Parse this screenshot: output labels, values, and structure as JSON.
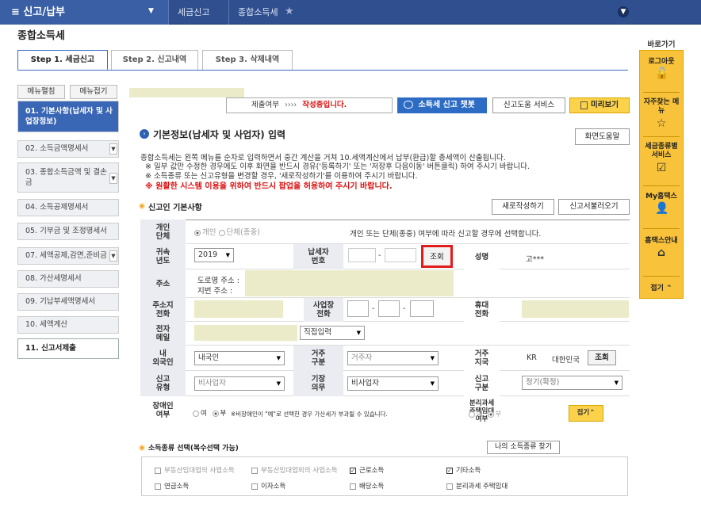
{
  "topbar": {
    "menu_label": "신고/납부",
    "crumb1": "세금신고",
    "crumb2": "종합소득세"
  },
  "page_title": "종합소득세",
  "tabs": [
    "Step 1. 세금신고",
    "Step 2. 신고내역",
    "Step 3. 삭제내역"
  ],
  "leftnav": {
    "expand_all": "메뉴펼침",
    "collapse_all": "메뉴접기",
    "items": [
      "01. 기본사항(납세자 및 사업장정보)",
      "02. 소득금액명세서",
      "03. 종합소득금액 및 결손금",
      "04. 소득공제명세서",
      "05. 기부금 및 조정명세서",
      "07. 세액공제,감면,준비금",
      "08. 가산세명세서",
      "09. 기납부세액명세서",
      "10. 세액계산",
      "11. 신고서제출"
    ]
  },
  "quickmenu": {
    "title": "바로가기",
    "items": [
      "로그아웃",
      "자주찾는 메뉴",
      "세금종류별 서비스",
      "My홈택스",
      "홈택스안내"
    ],
    "fold": "접기 ⌃"
  },
  "status": {
    "label": "제출여부",
    "arrows": "››››",
    "value": "작성중입니다."
  },
  "buttons": {
    "chatbot": "소득세 신고 챗봇",
    "help_service": "신고도움 서비스",
    "preview": "미리보기",
    "screen_help": "화면도움말",
    "new_write": "새로작성하기",
    "load": "신고서불러오기",
    "lookup": "조회",
    "lookup2": "조회",
    "fold": "접기⌃",
    "my_income_types": "나의 소득종류 찾기"
  },
  "section": {
    "title": "기본정보(납세자 및 사업자) 입력",
    "info1": "종합소득세는 왼쪽 메뉴를 순차로 입력하면서 중간 계산을 거쳐 10.세액계산에서 납부(환급)할 총세액이 산출됩니다.",
    "info2": "※ 일부 값만 수정한 경우에도 이후 화면을 반드시 경유('등록하기' 또는 '저장후 다음이동' 버튼클릭) 하여 주시기 바랍니다.",
    "info3": "※ 소득종류 또는 신고유형을 변경할 경우, '새로작성하기'를 이용하여 주시기 바랍니다.",
    "warning": "※ 원활한 시스템 이용을 위하여 반드시 팝업을 허용하여 주시기 바랍니다.",
    "subtitle": "신고인 기본사항"
  },
  "form": {
    "type_label": "개인\n단체",
    "type_opt1": "개인",
    "type_opt2": "단체(종중)",
    "type_note": "개인 또는 단체(종중) 여부에 따라 신고할 경우에 선택합니다.",
    "year_label": "귀속\n년도",
    "year_value": "2019",
    "taxpayer_id_label": "납세자\n번호",
    "name_label": "성명",
    "name_value": "고***",
    "address_label": "주소",
    "road_address": "도로명 주소 :",
    "lot_address": "지번 주소 :",
    "home_phone_label": "주소지\n전화",
    "biz_phone_label": "사업장\n전화",
    "mobile_label": "휴대\n전화",
    "email_label": "전자\n메일",
    "email_select": "직접입력",
    "residency_label": "내\n외국인",
    "residency_value": "내국인",
    "resident_label": "거주\n구분",
    "resident_value": "거주자",
    "country_label": "거주\n지국",
    "country_code": "KR",
    "country_name": "대한민국",
    "report_type_label": "신고\n유형",
    "report_type_value": "비사업자",
    "bookkeeping_label": "기장\n의무",
    "bookkeeping_value": "비사업자",
    "report_class_label": "신고\n구분",
    "report_class_value": "정기(확정)",
    "disabled_label": "장애인\n여부",
    "disabled_yes": "여",
    "disabled_no": "부",
    "disabled_note": "※비장애인이 \"예\"로 선택한 경우 가산세가 부과될 수 있습니다.",
    "separate_tax_label": "분리과세\n주택임대\n여부",
    "sep_yes": "여",
    "sep_no": "부"
  },
  "income": {
    "title": "소득종류 선택(복수선택 가능)",
    "items": [
      {
        "label": "부동산임대업의 사업소득",
        "checked": false
      },
      {
        "label": "부동산임대업외의 사업소득",
        "checked": false
      },
      {
        "label": "근로소득",
        "checked": true
      },
      {
        "label": "기타소득",
        "checked": true
      },
      {
        "label": "연금소득",
        "checked": false
      },
      {
        "label": "이자소득",
        "checked": false
      },
      {
        "label": "배당소득",
        "checked": false
      },
      {
        "label": "분리과세 주택임대",
        "checked": false
      }
    ]
  }
}
